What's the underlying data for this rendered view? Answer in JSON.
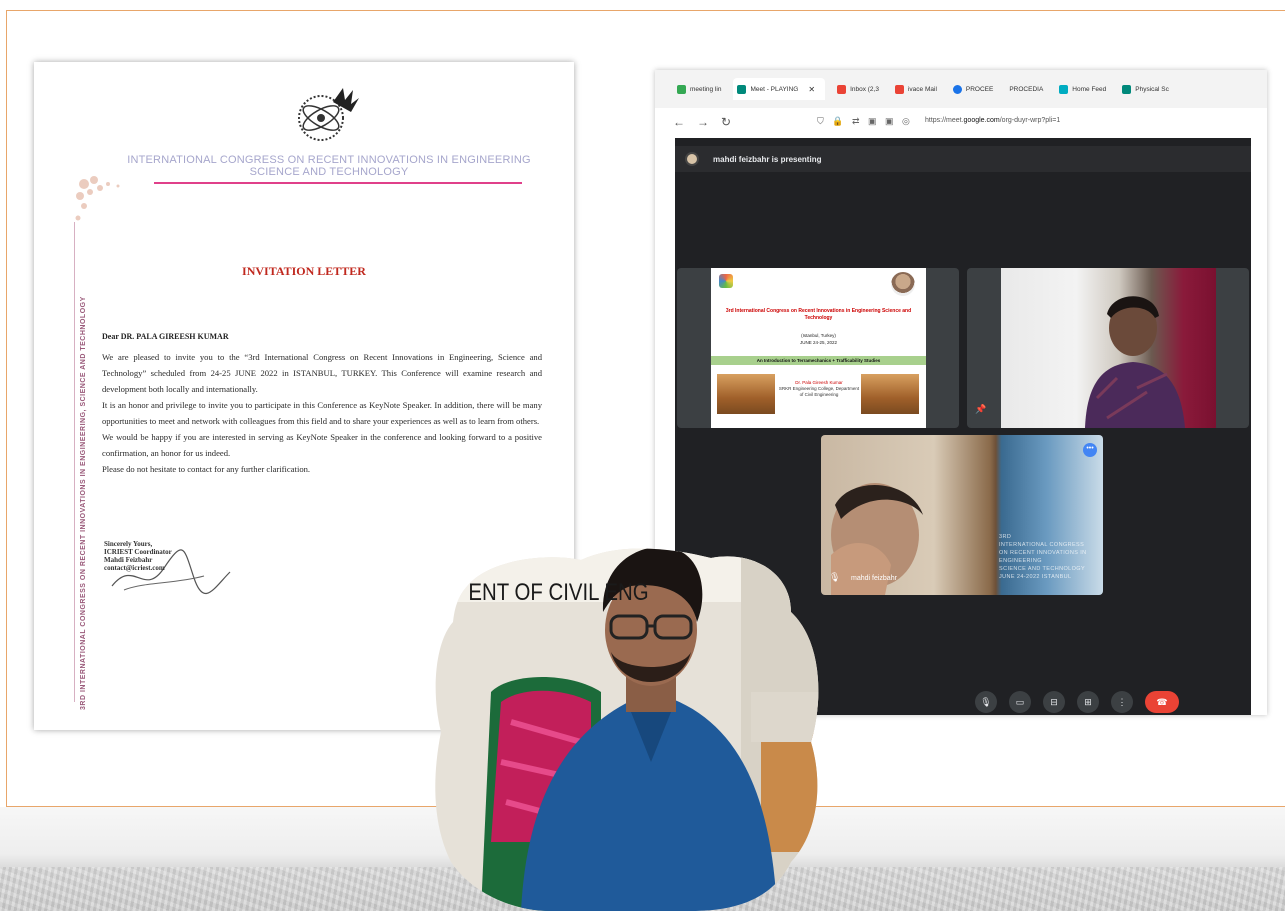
{
  "letter": {
    "congress_title": "INTERNATIONAL CONGRESS ON RECENT INNOVATIONS IN ENGINEERING SCIENCE AND TECHNOLOGY",
    "side_text": "3RD INTERNATIONAL CONGRESS ON RECENT INNOVATIONS IN ENGINEERING, SCIENCE AND TECHNOLOGY",
    "heading": "INVITATION LETTER",
    "salutation": "Dear DR. PALA GIREESH KUMAR",
    "paragraphs": [
      "We are pleased to invite you to the “3rd International Congress on Recent Innovations in Engineering, Science and Technology” scheduled from 24-25 JUNE 2022 in ISTANBUL, TURKEY. This Conference will examine research and development both locally and internationally.",
      "It is an honor and privilege to invite you to participate in this Conference as KeyNote Speaker. In addition, there will be many opportunities to meet and network with colleagues from this field and to share your experiences as well as to learn from others.",
      "We would be happy if you are interested in serving as KeyNote Speaker in the conference and looking forward to a positive confirmation, an honor for us indeed.",
      "Please do not hesitate to contact for any further clarification."
    ],
    "sign_lines": [
      "Sincerely Yours,",
      "ICRIEST Coordinator",
      "Mahdi Feizbahr",
      "contact@icriest.com"
    ]
  },
  "browser": {
    "tabs": [
      {
        "label": "meeting lin",
        "color": "#34a853"
      },
      {
        "label": "Meet - PLAYING",
        "color": "#00897b",
        "active": true
      },
      {
        "label": "Inbox (2,3",
        "color": "#ea4335"
      },
      {
        "label": "ivace Mail",
        "color": "#ea4335"
      },
      {
        "label": "PROCEE",
        "color": "#1a73e8"
      },
      {
        "label": "PROCEDIA",
        "color": "#888888"
      },
      {
        "label": "Home Feed",
        "color": "#00acc1"
      },
      {
        "label": "Physical Sc",
        "color": "#00897b"
      }
    ],
    "url_prefix": "https://meet.",
    "url_domain": "google.com",
    "url_suffix": "/org-duyr-wrp?pli=1"
  },
  "meet": {
    "presenting_text": "mahdi feizbahr is presenting",
    "slide": {
      "title": "3rd International Congress on Recent Innovations in Engineering Science and Technology",
      "location": "(Istanbul, Turkey)",
      "date": "JUNE 24-25, 2022",
      "banner": "An Introduction to Terramechanics + Trafficability Studies",
      "author": "Dr. Pala Gireesh Kumar",
      "dept": "SRKR Engineering College, Department of Civil Engineering"
    },
    "participant_name": "mahdi feizbahr",
    "overlay_text": [
      "3RD",
      "INTERNATIONAL CONGRESS",
      "ON RECENT INNOVATIONS IN ENGINEERING",
      "SCIENCE AND TECHNOLOGY",
      "JUNE 24-2022 ISTANBUL"
    ]
  },
  "portrait": {
    "sign_text": "ENT OF CIVIL ENG"
  }
}
